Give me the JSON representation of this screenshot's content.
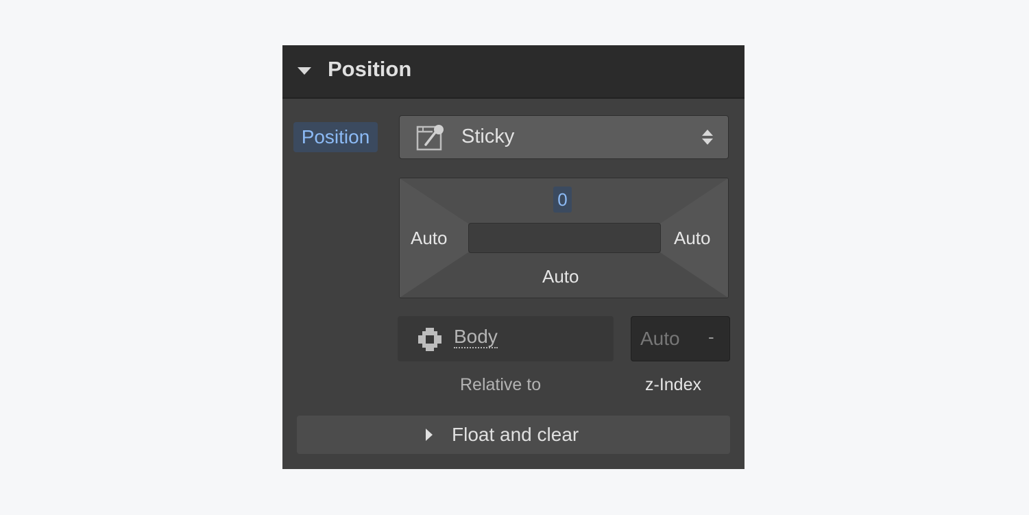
{
  "section": {
    "title": "Position",
    "expanded": true
  },
  "position": {
    "label": "Position",
    "select_value": "Sticky",
    "select_icon": "sticky-position-icon"
  },
  "offsets": {
    "top": "0",
    "left": "Auto",
    "right": "Auto",
    "bottom": "Auto"
  },
  "relative_to": {
    "value": "Body",
    "icon": "element-icon",
    "label": "Relative to"
  },
  "z_index": {
    "placeholder": "Auto",
    "stepper": "-",
    "label": "z-Index"
  },
  "float_section": {
    "title": "Float and clear",
    "expanded": false
  },
  "colors": {
    "accent": "#8cbaf5",
    "panel_bg": "#404040",
    "header_bg": "#2b2b2b"
  }
}
